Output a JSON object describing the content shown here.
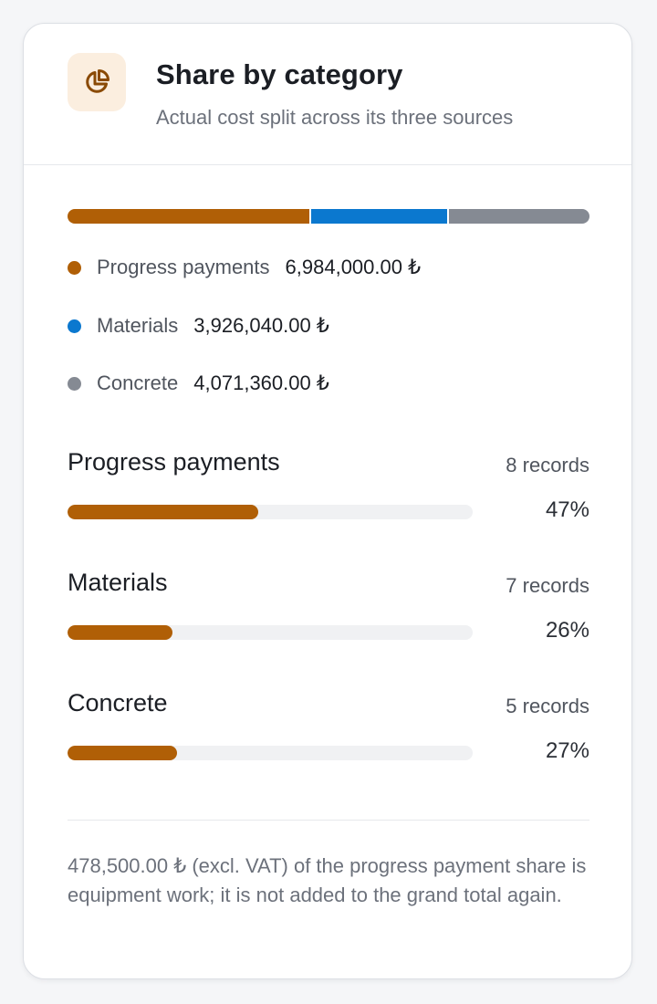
{
  "card": {
    "title": "Share by category",
    "subtitle": "Actual cost split across its three sources",
    "icon": "pie-chart-icon"
  },
  "colors": {
    "progress": "#b05f06",
    "materials": "#0b78cf",
    "concrete": "#858a93",
    "track": "#f0f1f3",
    "icon_bg": "#fbeedf"
  },
  "legend": [
    {
      "label": "Progress payments",
      "value": "6,984,000.00 ₺",
      "share": 0.4662
    },
    {
      "label": "Materials",
      "value": "3,926,040.00 ₺",
      "share": 0.2621
    },
    {
      "label": "Concrete",
      "value": "4,071,360.00 ₺",
      "share": 0.2717
    }
  ],
  "categories": [
    {
      "name": "Progress payments",
      "count": "8 records",
      "pct": "47%",
      "fraction": 0.47
    },
    {
      "name": "Materials",
      "count": "7 records",
      "pct": "26%",
      "fraction": 0.26
    },
    {
      "name": "Concrete",
      "count": "5 records",
      "pct": "27%",
      "fraction": 0.27
    }
  ],
  "footnote": "478,500.00 ₺ (excl. VAT) of the progress payment share is equipment work; it is not added to the grand total again."
}
